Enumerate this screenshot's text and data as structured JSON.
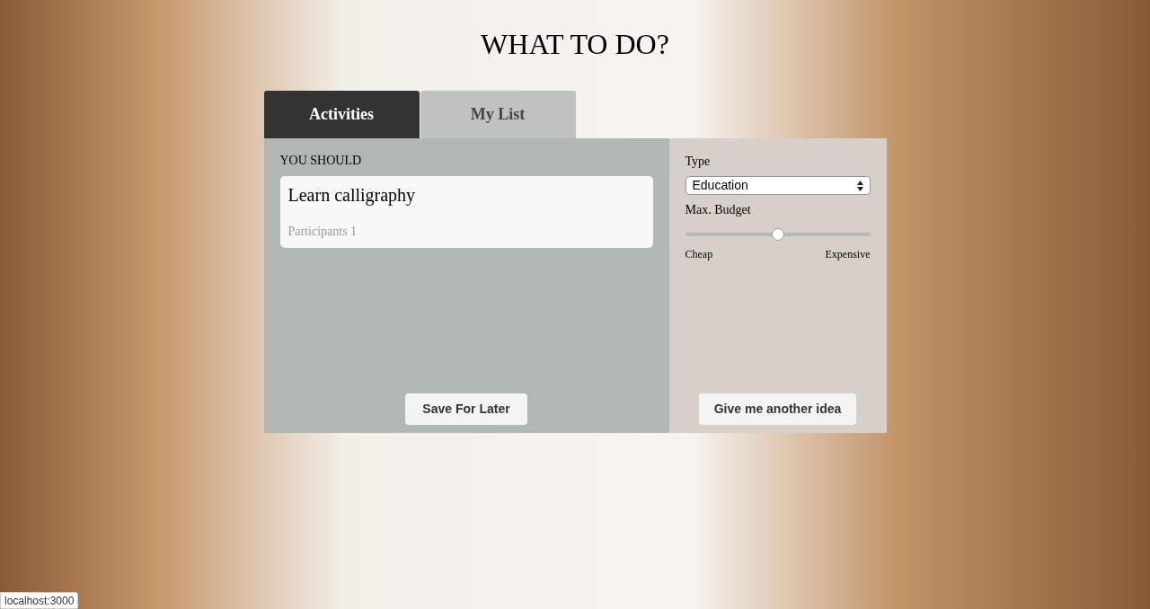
{
  "title": "WHAT TO DO?",
  "tabs": [
    {
      "label": "Activities",
      "selected": true
    },
    {
      "label": "My List",
      "selected": false
    }
  ],
  "suggestion": {
    "heading": "YOU SHOULD",
    "activity": "Learn calligraphy",
    "participants": "Participants 1",
    "button": "Save For Later"
  },
  "filters": {
    "type_label": "Type",
    "type_value": "Education",
    "budget_label": "Max. Budget",
    "budget": {
      "level": 0.5,
      "min_label": "Cheap",
      "max_label": "Expensive"
    },
    "button": "Give me another idea"
  },
  "status_bar": "localhost:3000"
}
